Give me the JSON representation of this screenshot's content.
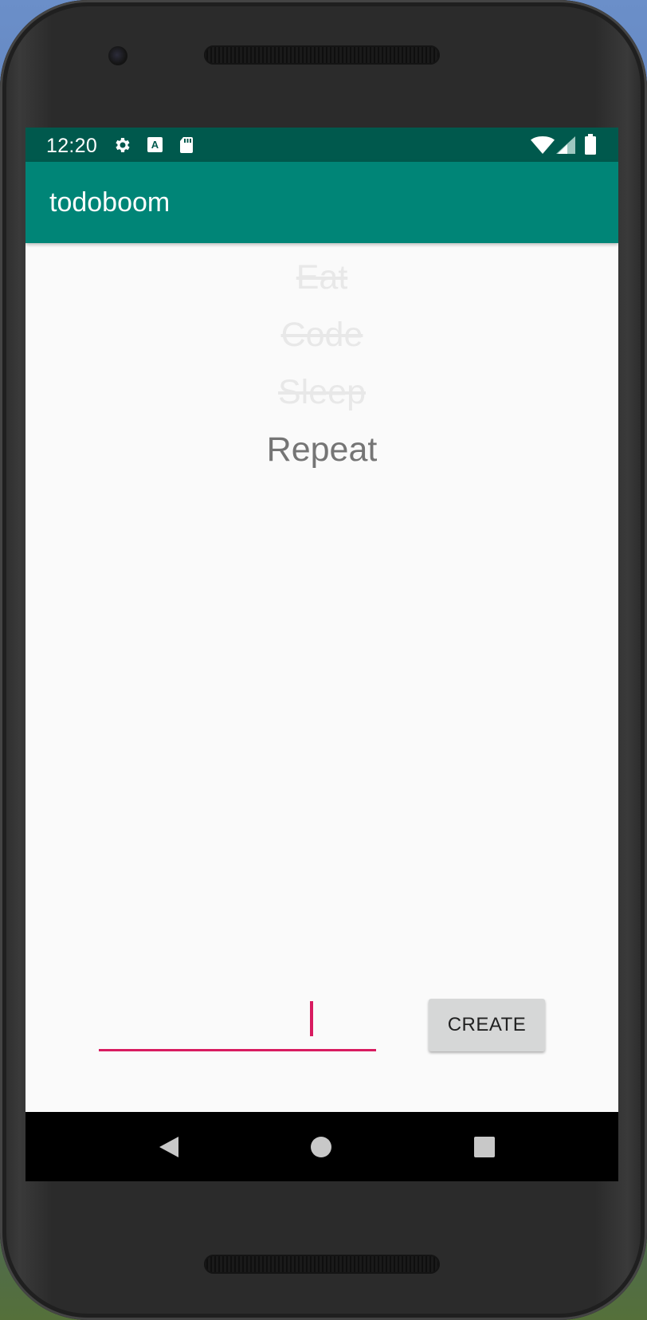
{
  "status_bar": {
    "time": "12:20",
    "icons": [
      "settings-icon",
      "keyboard-a-icon",
      "sd-card-icon",
      "wifi-icon",
      "signal-icon",
      "battery-icon"
    ]
  },
  "app_bar": {
    "title": "todoboom"
  },
  "todos": [
    {
      "text": "Eat",
      "done": true
    },
    {
      "text": "Code",
      "done": true
    },
    {
      "text": "Sleep",
      "done": true
    },
    {
      "text": "Repeat",
      "done": false
    }
  ],
  "input": {
    "value": "",
    "placeholder": ""
  },
  "create_button": {
    "label": "CREATE"
  },
  "nav_bar": {
    "icons": [
      "back-icon",
      "home-icon",
      "recents-icon"
    ]
  },
  "colors": {
    "status_bar": "#00594d",
    "app_bar": "#008577",
    "accent": "#d81b60",
    "done_text": "#e8e8e8",
    "active_text": "#757575"
  }
}
